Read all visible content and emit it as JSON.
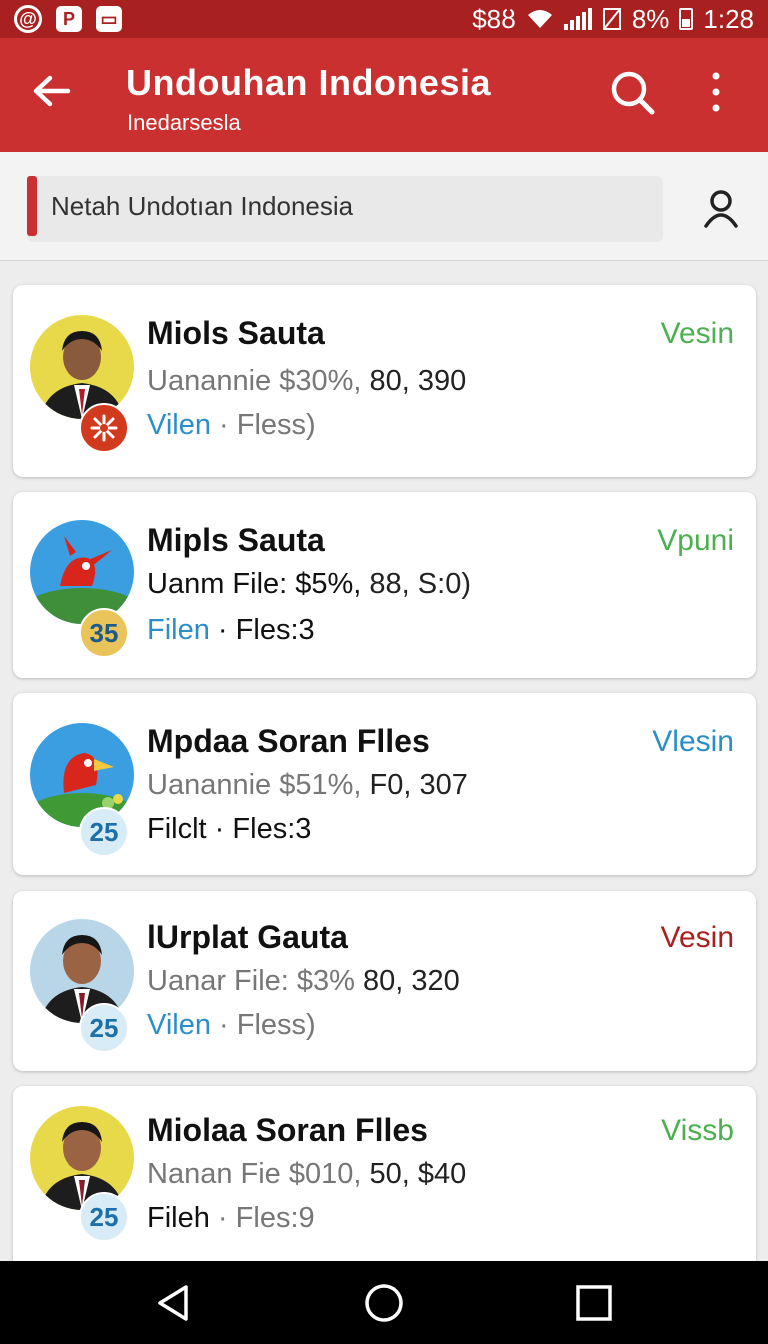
{
  "status_bar": {
    "left_icons": [
      "at-icon",
      "parking-icon",
      "card-icon"
    ],
    "right_text": "$8ȣ",
    "battery": "8%",
    "time": "1:28"
  },
  "app_bar": {
    "title": "Undouhan Indonesia",
    "subtitle": "Inedarsesla"
  },
  "search": {
    "placeholder": "Netah Undotıan Indonesia"
  },
  "items": [
    {
      "name": "Miols Sauta",
      "detail_prefix": "Uanannie $30%,",
      "detail_value": "80, 390",
      "link": "Vilen",
      "files": "Fless)",
      "status": "Vesin",
      "status_color": "#4caf50",
      "badge": "",
      "badge_bg": "#d23a1e",
      "avatar_bg": "#e8d94a"
    },
    {
      "name": "Mipls Sauta",
      "detail_prefix": "Uanm File: $5%,",
      "detail_value": "88, S:0)",
      "link": "Filen",
      "files": "Fles:3",
      "status": "Vpuni",
      "status_color": "#4caf50",
      "badge": "35",
      "badge_bg": "#e8c45a",
      "avatar_bg": "#3a9ee0"
    },
    {
      "name": "Mpdaa Soran Flles",
      "detail_prefix": "Uanannie $51%,",
      "detail_value": "F0, 307",
      "link": "Filclt",
      "files": "Fles:3",
      "status": "Vlesin",
      "status_color": "#2b8ec9",
      "badge": "25",
      "badge_bg": "#d8ecf8",
      "avatar_bg": "#3a9ee0"
    },
    {
      "name": "lUrplat Gauta",
      "detail_prefix": "Uanar File: $3%",
      "detail_value": "80, 320",
      "link": "Vilen",
      "files": "Fless)",
      "status": "Vesin",
      "status_color": "#a8201f",
      "badge": "25",
      "badge_bg": "#d8ecf8",
      "avatar_bg": "#b8d6e8"
    },
    {
      "name": "Miolaa Soran Flles",
      "detail_prefix": "Nanan Fie $010,",
      "detail_value": "50, $40",
      "link": "Fileh",
      "files": "Fles:9",
      "status": "Vissb",
      "status_color": "#4caf50",
      "badge": "25",
      "badge_bg": "#d8ecf8",
      "avatar_bg": "#e8d94a"
    }
  ],
  "nav": [
    "back-icon",
    "home-icon",
    "recents-icon"
  ]
}
